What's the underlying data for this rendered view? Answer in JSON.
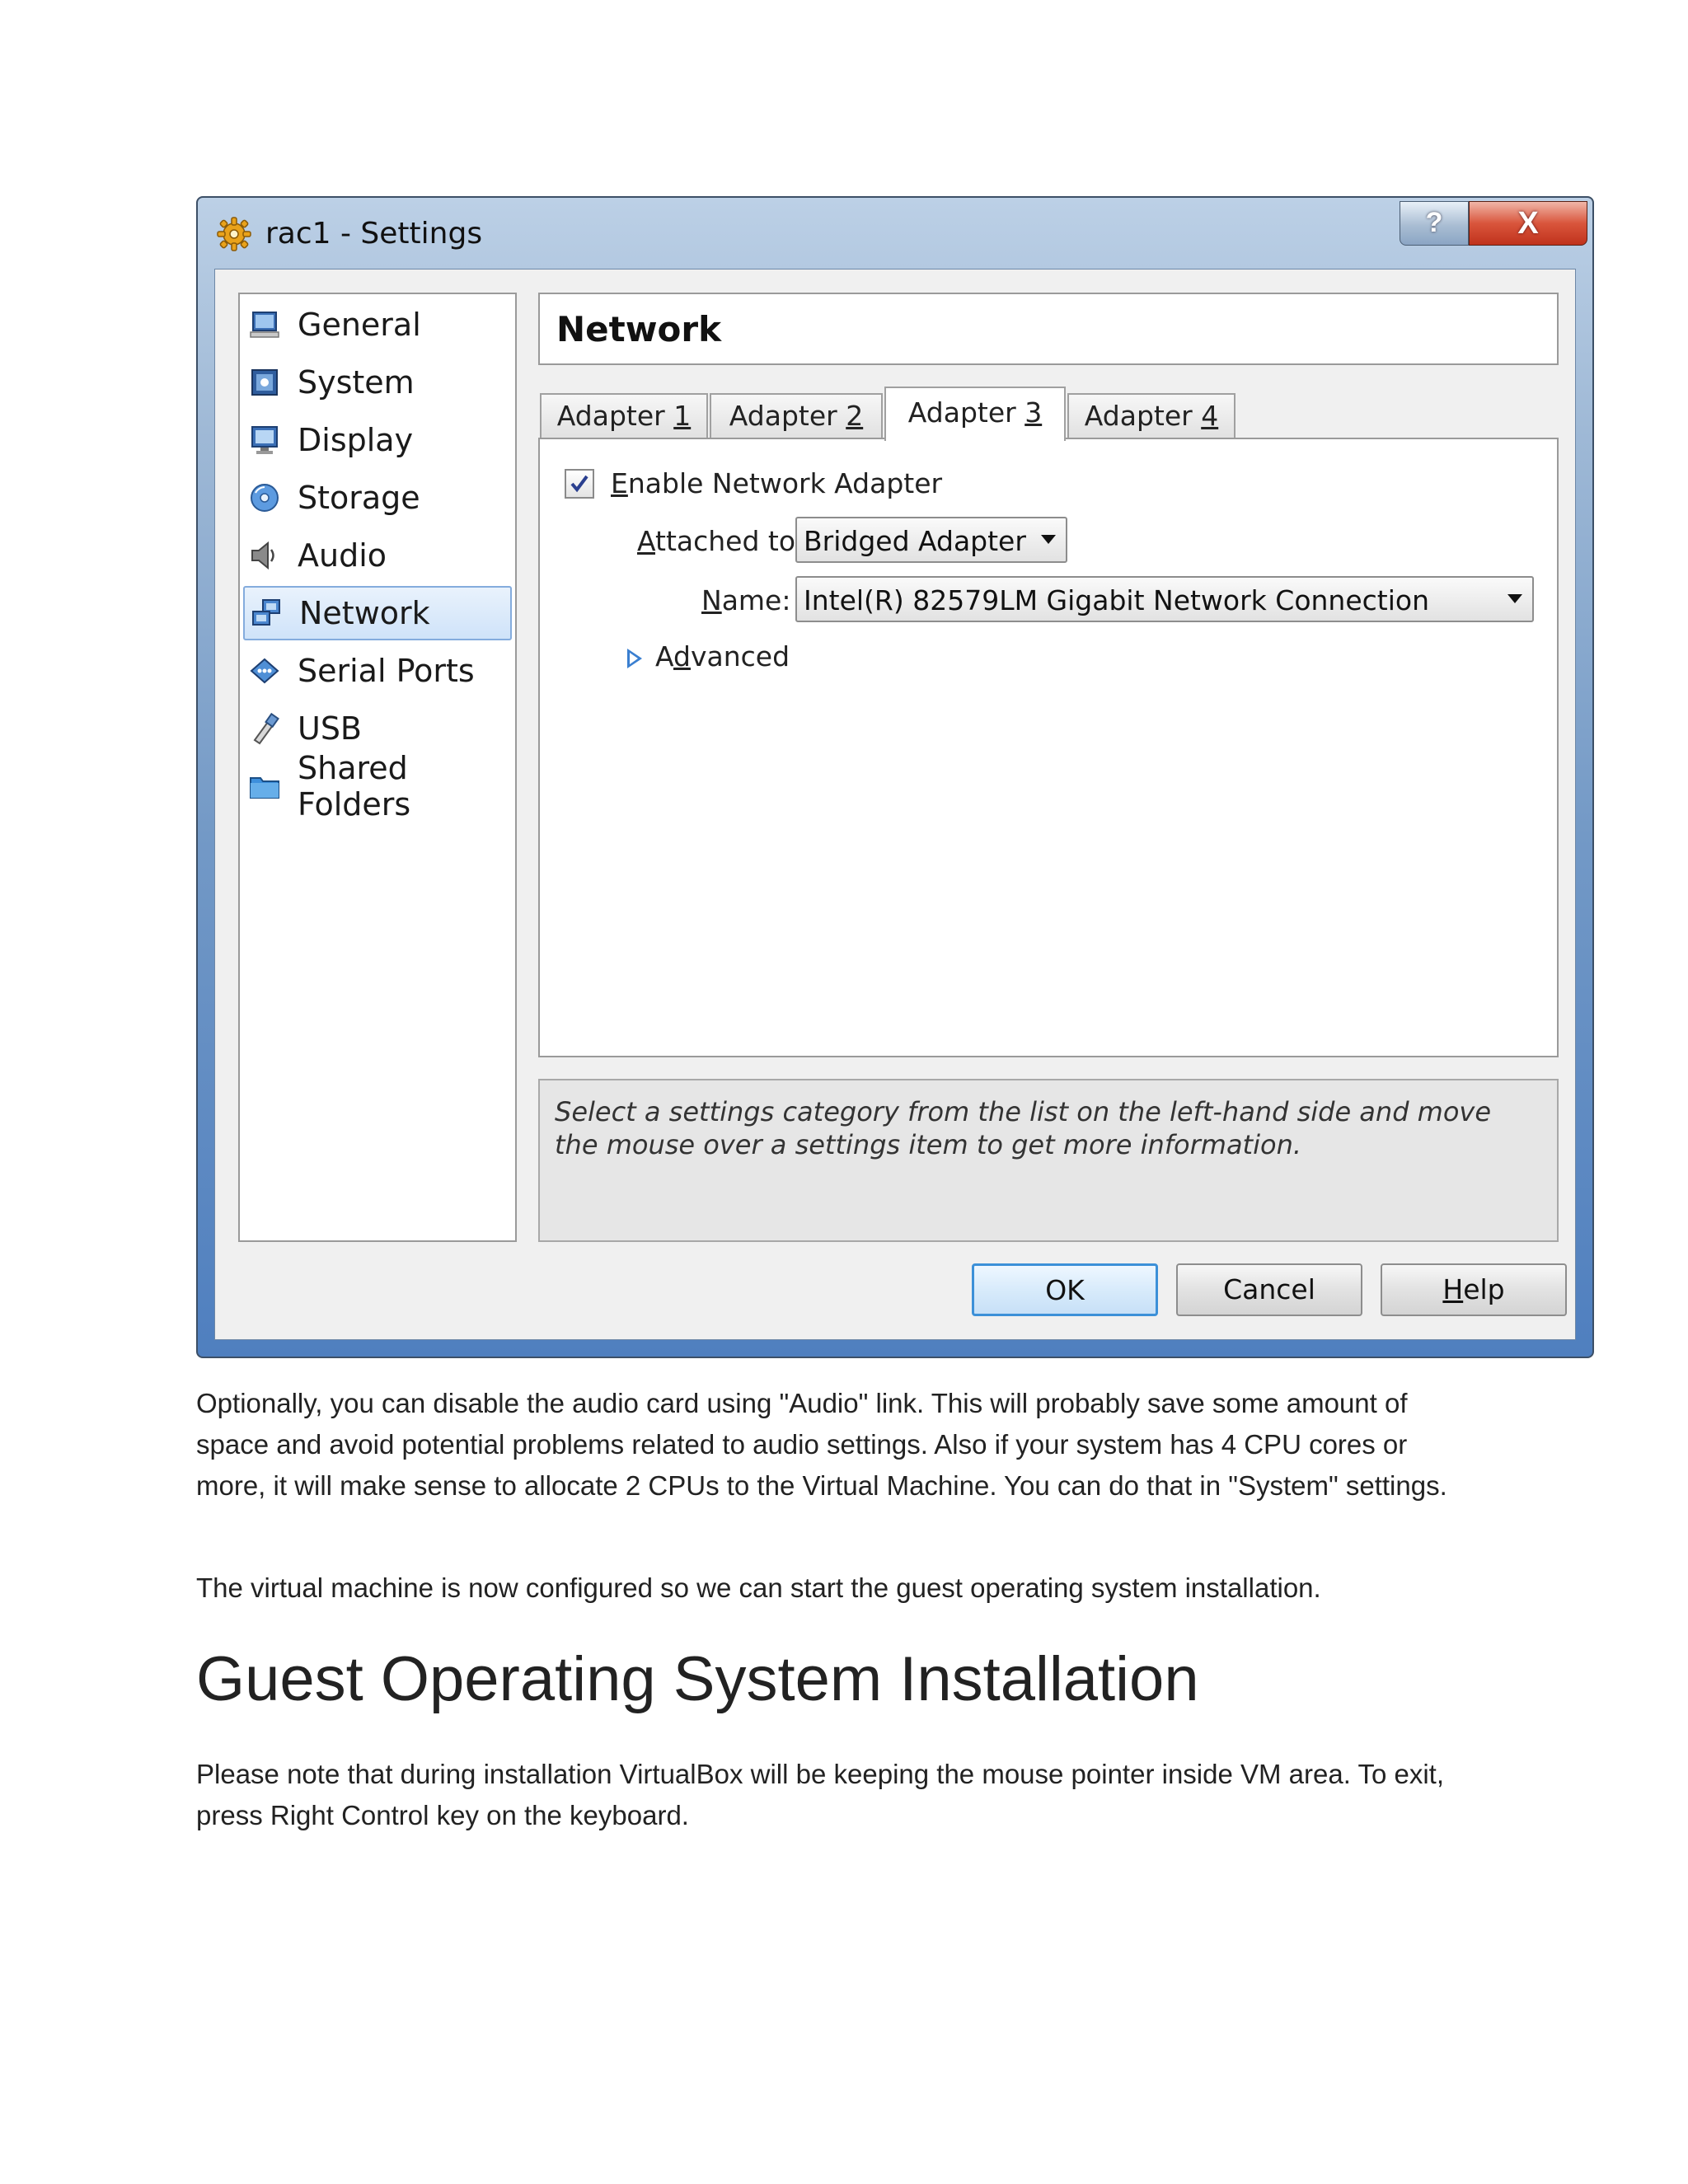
{
  "window": {
    "title": "rac1 - Settings",
    "help_glyph": "?",
    "close_glyph": "X"
  },
  "sidebar": {
    "items": [
      {
        "label": "General",
        "icon": "general-icon"
      },
      {
        "label": "System",
        "icon": "system-icon"
      },
      {
        "label": "Display",
        "icon": "display-icon"
      },
      {
        "label": "Storage",
        "icon": "storage-icon"
      },
      {
        "label": "Audio",
        "icon": "audio-icon"
      },
      {
        "label": "Network",
        "icon": "network-icon",
        "selected": true
      },
      {
        "label": "Serial Ports",
        "icon": "serial-ports-icon"
      },
      {
        "label": "USB",
        "icon": "usb-icon"
      },
      {
        "label": "Shared Folders",
        "icon": "shared-folders-icon"
      }
    ]
  },
  "page": {
    "title": "Network"
  },
  "tabs": [
    {
      "prefix": "Adapter ",
      "mnemonic": "1",
      "active": false
    },
    {
      "prefix": "Adapter ",
      "mnemonic": "2",
      "active": false
    },
    {
      "prefix": "Adapter ",
      "mnemonic": "3",
      "active": true
    },
    {
      "prefix": "Adapter ",
      "mnemonic": "4",
      "active": false
    }
  ],
  "adapter": {
    "enable": {
      "mnemonic": "E",
      "rest": "nable Network Adapter",
      "checked": true
    },
    "attached": {
      "mnemonic": "A",
      "rest": "ttached to:",
      "value": "Bridged Adapter"
    },
    "name": {
      "mnemonic": "N",
      "rest": "ame:",
      "value": "Intel(R) 82579LM Gigabit Network Connection"
    },
    "advanced": {
      "pre": "A",
      "mnemonic": "d",
      "rest": "vanced"
    }
  },
  "info": {
    "text": "Select a settings category from the list on the left-hand side and move the mouse over a settings item to get more information."
  },
  "buttons": {
    "ok": "OK",
    "cancel": "Cancel",
    "help_mnemonic": "H",
    "help_rest": "elp"
  },
  "document": {
    "para1": "Optionally, you can disable the audio card using \"Audio\" link. This will probably save some amount of space and avoid potential problems related to audio settings. Also if your system has 4 CPU cores or more, it will make sense to allocate 2 CPUs to the Virtual Machine. You can do that in \"System\" settings.",
    "para2": "The virtual machine is now configured so we can start the guest operating system installation.",
    "heading": "Guest Operating System Installation",
    "para3": "Please note that during installation VirtualBox will be keeping the mouse pointer inside VM area. To exit, press Right Control key on the keyboard."
  },
  "colors": {
    "selection": "#cfe3f9",
    "close_button": "#d9553c",
    "default_button_border": "#3c90d8"
  }
}
